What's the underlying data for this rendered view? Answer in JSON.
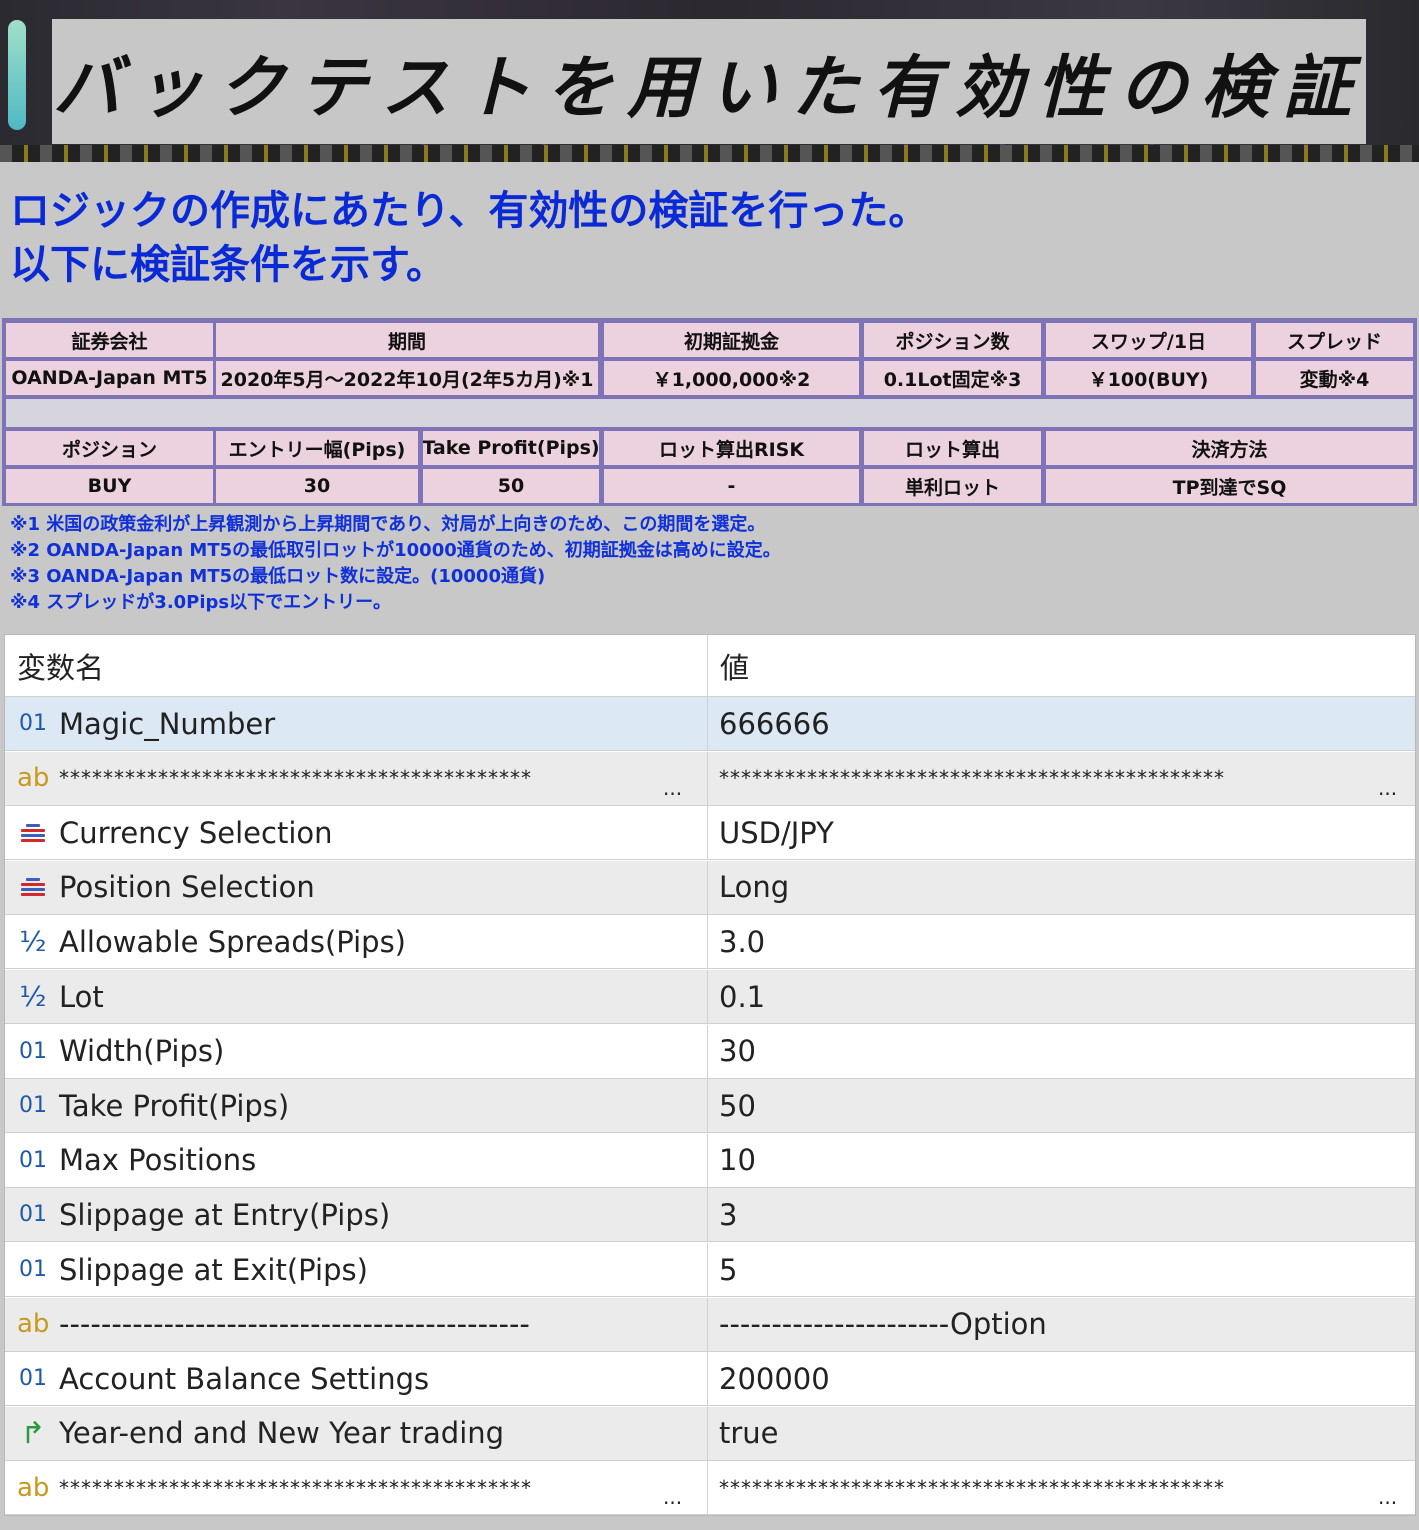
{
  "banner": {
    "title": "バックテストを用いた有効性の検証"
  },
  "intro": {
    "line1": "ロジックの作成にあたり、有効性の検証を行った。",
    "line2": "以下に検証条件を示す。"
  },
  "conditions": {
    "row1_headers": [
      "証券会社",
      "期間",
      "初期証拠金",
      "ポジション数",
      "スワップ/1日",
      "スプレッド"
    ],
    "row1_values": [
      "OANDA-Japan MT5",
      "2020年5月～2022年10月(2年5カ月)※1",
      "￥1,000,000※2",
      "0.1Lot固定※3",
      "￥100(BUY)",
      "変動※4"
    ],
    "row2_headers": [
      "ポジション",
      "エントリー幅(Pips)",
      "Take Profit(Pips)",
      "ロット算出RISK",
      "ロット算出",
      "決済方法"
    ],
    "row2_values": [
      "BUY",
      "30",
      "50",
      "-",
      "単利ロット",
      "TP到達でSQ"
    ]
  },
  "notes": [
    "※1 米国の政策金利が上昇観測から上昇期間であり、対局が上向きのため、この期間を選定。",
    "※2 OANDA-Japan MT5の最低取引ロットが10000通貨のため、初期証拠金は高めに設定。",
    "※3 OANDA-Japan MT5の最低ロット数に設定。(10000通貨)",
    "※4 スプレッドが3.0Pips以下でエントリー。"
  ],
  "params": {
    "header": {
      "name": "変数名",
      "value": "値"
    },
    "rows": [
      {
        "icon": "int",
        "name": "Magic_Number",
        "value": "666666"
      },
      {
        "icon": "str",
        "name": "*******************************************",
        "value": "**********************************************",
        "ellipsis": "..."
      },
      {
        "icon": "enum",
        "name": "Currency Selection",
        "value": "USD/JPY"
      },
      {
        "icon": "enum",
        "name": "Position Selection",
        "value": "Long"
      },
      {
        "icon": "dbl",
        "name": "Allowable Spreads(Pips)",
        "value": "3.0"
      },
      {
        "icon": "dbl",
        "name": "Lot",
        "value": "0.1"
      },
      {
        "icon": "int",
        "name": "Width(Pips)",
        "value": "30"
      },
      {
        "icon": "int",
        "name": "Take Profit(Pips)",
        "value": "50"
      },
      {
        "icon": "int",
        "name": "Max Positions",
        "value": "10"
      },
      {
        "icon": "int",
        "name": "Slippage at Entry(Pips)",
        "value": "3"
      },
      {
        "icon": "int",
        "name": "Slippage at Exit(Pips)",
        "value": "5"
      },
      {
        "icon": "str",
        "name": "---------------------------------------------",
        "value": "----------------------Option"
      },
      {
        "icon": "int",
        "name": "Account Balance Settings",
        "value": "200000"
      },
      {
        "icon": "bool",
        "name": "Year-end and New Year trading",
        "value": "true"
      },
      {
        "icon": "str",
        "name": "*******************************************",
        "value": "**********************************************",
        "ellipsis": "..."
      }
    ]
  },
  "icon_glyphs": {
    "int": "01",
    "str": "ab",
    "dbl": "½",
    "bool": "↱"
  },
  "colors": {
    "intro_text": "#0a2ad6",
    "table_border": "#7f73b8",
    "cell_bg": "#ecd2de",
    "selected_row": "#dce9f5"
  }
}
